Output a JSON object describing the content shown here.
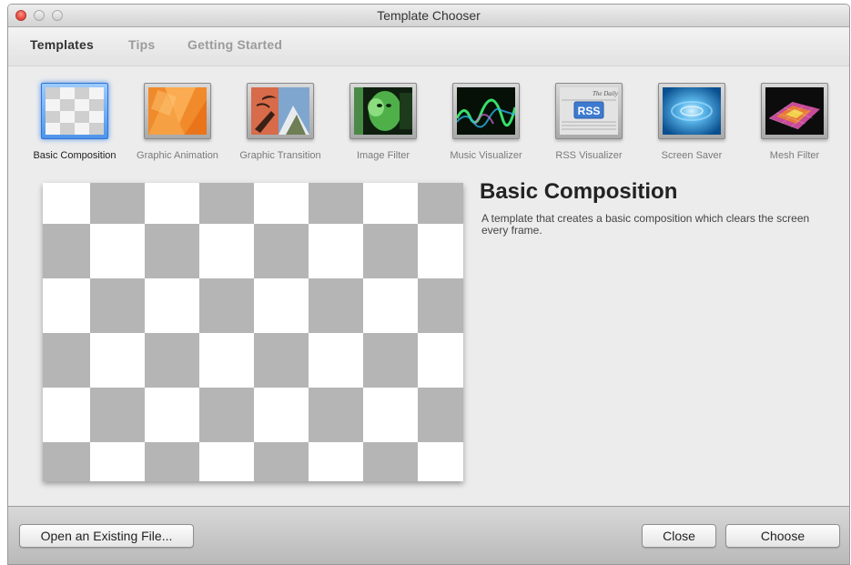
{
  "window": {
    "title": "Template Chooser"
  },
  "tabs": [
    {
      "label": "Templates",
      "active": true
    },
    {
      "label": "Tips",
      "active": false
    },
    {
      "label": "Getting Started",
      "active": false
    }
  ],
  "templates": [
    {
      "label": "Basic Composition",
      "icon": "checkerboard-icon",
      "selected": true
    },
    {
      "label": "Graphic Animation",
      "icon": "orange-shapes-icon",
      "selected": false
    },
    {
      "label": "Graphic Transition",
      "icon": "transition-photo-icon",
      "selected": false
    },
    {
      "label": "Image Filter",
      "icon": "green-face-icon",
      "selected": false
    },
    {
      "label": "Music Visualizer",
      "icon": "audio-wave-icon",
      "selected": false
    },
    {
      "label": "RSS Visualizer",
      "icon": "rss-newspaper-icon",
      "badge": "RSS",
      "masthead": "The Daily",
      "selected": false
    },
    {
      "label": "Screen Saver",
      "icon": "blue-swirl-icon",
      "selected": false
    },
    {
      "label": "Mesh Filter",
      "icon": "mesh-surface-icon",
      "selected": false
    }
  ],
  "detail": {
    "title": "Basic Composition",
    "description": "A template that creates a basic composition which clears the screen every frame."
  },
  "buttons": {
    "open_existing": "Open an Existing File...",
    "close": "Close",
    "choose": "Choose"
  },
  "colors": {
    "checker_gray": "#b5b5b5",
    "selection_blue": "#4f95ea"
  }
}
